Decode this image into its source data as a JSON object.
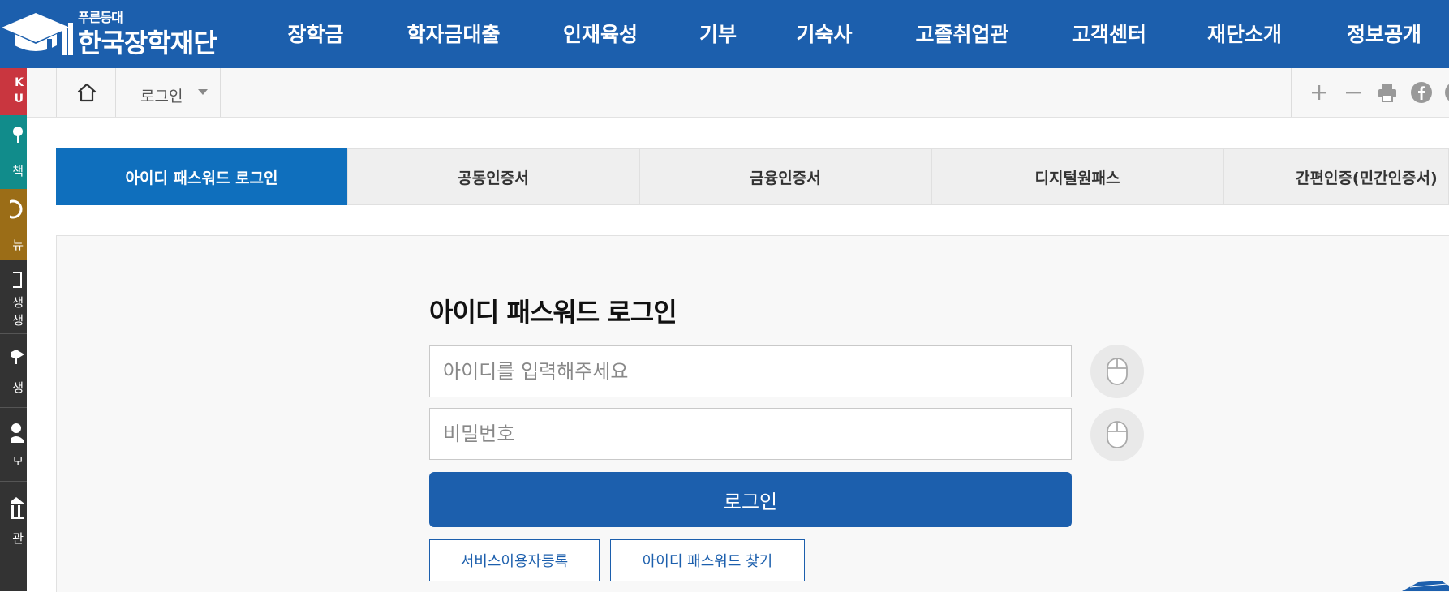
{
  "header": {
    "logo_small": "푸른등대",
    "logo_main": "한국장학재단",
    "nav": [
      "장학금",
      "학자금대출",
      "인재육성",
      "기부",
      "기숙사",
      "고졸취업관",
      "고객센터",
      "재단소개",
      "정보공개"
    ]
  },
  "quick_menu": {
    "items": [
      "K\nU",
      "책",
      "뉴",
      "생\n생",
      "생",
      "모",
      "관"
    ]
  },
  "breadcrumb": {
    "current": "로그인"
  },
  "tabs": [
    "아이디 패스워드 로그인",
    "공동인증서",
    "금융인증서",
    "디지털원패스",
    "간편인증(민간인증서)"
  ],
  "login": {
    "title": "아이디 패스워드 로그인",
    "id_placeholder": "아이디를 입력해주세요",
    "pw_placeholder": "비밀번호",
    "login_label": "로그인",
    "register_label": "서비스이용자등록",
    "find_label": "아이디 패스워드 찾기"
  },
  "colors": {
    "header_bg": "#1c5fad",
    "tab_active": "#0f6fbd",
    "button": "#1c5fad"
  }
}
